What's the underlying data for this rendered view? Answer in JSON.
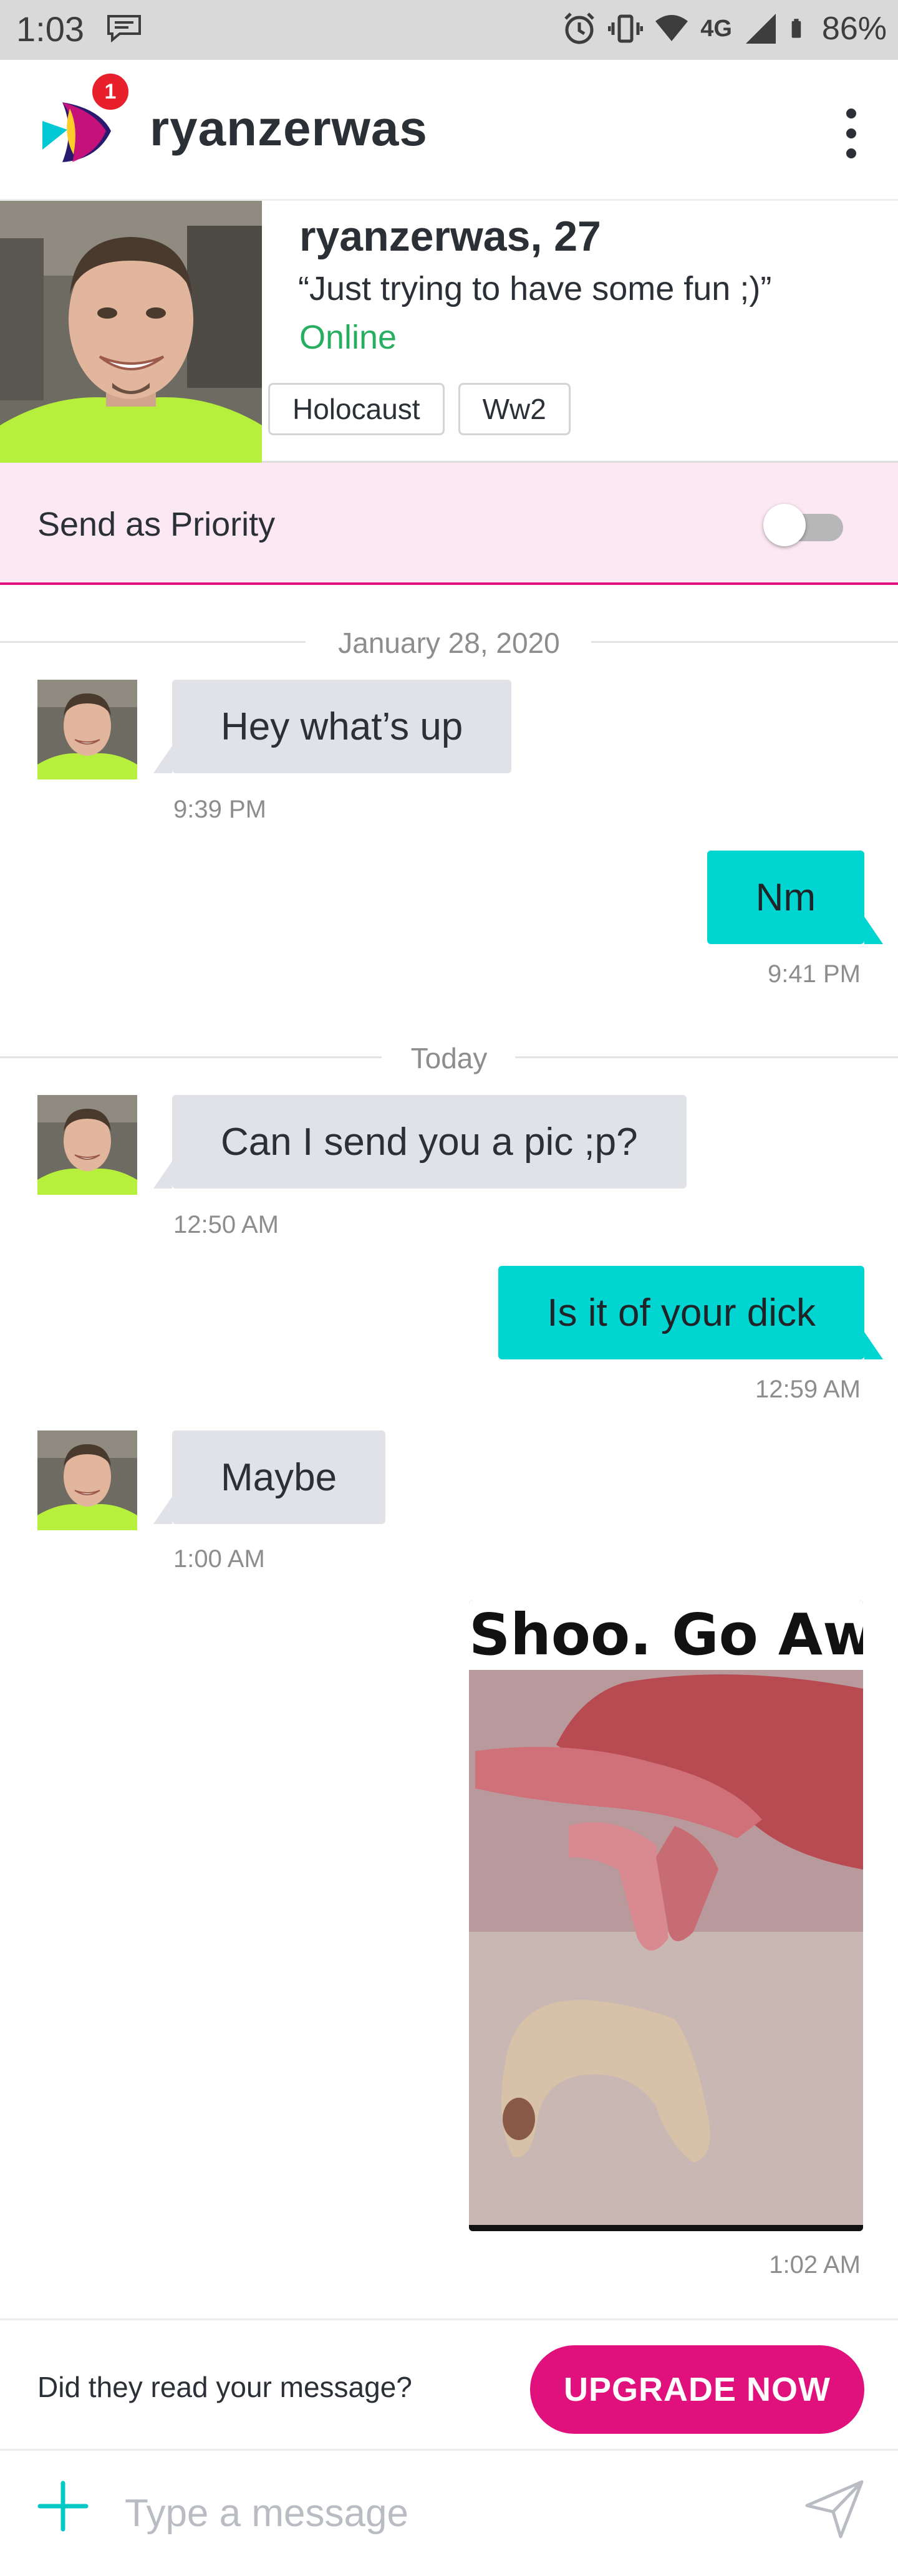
{
  "status_bar": {
    "time": "1:03",
    "network": "4G",
    "battery": "86%"
  },
  "header": {
    "app_title": "ryanzerwas",
    "notification_count": "1"
  },
  "profile": {
    "name_age": "ryanzerwas, 27",
    "tagline": "“Just trying to have some fun ;)”",
    "status": "Online",
    "tags": [
      "Holocaust",
      "Ww2"
    ]
  },
  "priority": {
    "label": "Send as Priority",
    "enabled": false
  },
  "dividers": [
    "January 28, 2020",
    "Today"
  ],
  "messages": [
    {
      "from": "them",
      "text": "Hey what’s up",
      "time": "9:39 PM"
    },
    {
      "from": "me",
      "text": "Nm",
      "time": "9:41 PM"
    },
    {
      "from": "them",
      "text": "Can I send you a pic ;p?",
      "time": "12:50 AM"
    },
    {
      "from": "me",
      "text": "Is it of your dick",
      "time": "12:59 AM"
    },
    {
      "from": "them",
      "text": "Maybe",
      "time": "1:00 AM"
    },
    {
      "from": "me",
      "image_caption": "Shoo. Go Awa",
      "time": "1:02 AM"
    }
  ],
  "upgrade": {
    "prompt": "Did they read your message?",
    "button": "UPGRADE NOW"
  },
  "compose": {
    "placeholder": "Type a message"
  },
  "colors": {
    "accent_pink": "#e0117c",
    "outgoing_bubble": "#00d5d2",
    "incoming_bubble": "#e0e2e8",
    "online_green": "#27ae60"
  }
}
